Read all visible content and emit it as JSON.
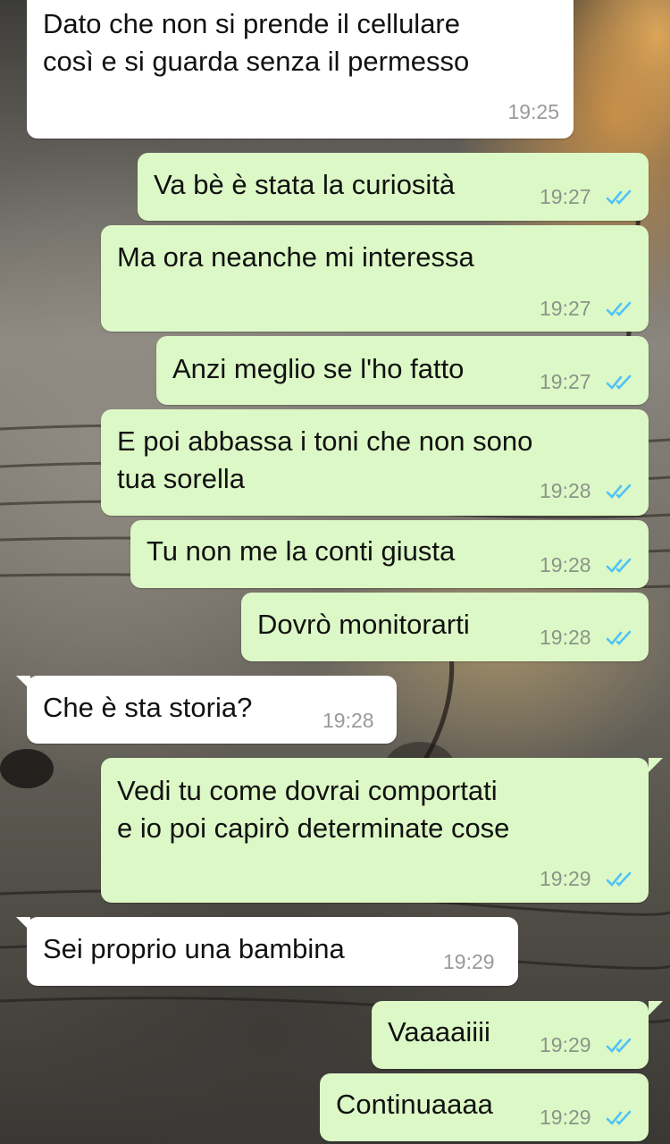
{
  "chat": {
    "messages": [
      {
        "direction": "in",
        "text": "Dato che non si prende il cellulare\ncosì e si guarda senza il permesso",
        "time": "19:25"
      },
      {
        "direction": "out",
        "text": "Va bè è stata la curiosità",
        "time": "19:27",
        "status": "read"
      },
      {
        "direction": "out",
        "text": "Ma ora neanche mi interessa",
        "time": "19:27",
        "status": "read"
      },
      {
        "direction": "out",
        "text": "Anzi meglio se l'ho fatto",
        "time": "19:27",
        "status": "read"
      },
      {
        "direction": "out",
        "text": "E poi abbassa i toni che non sono\ntua sorella",
        "time": "19:28",
        "status": "read"
      },
      {
        "direction": "out",
        "text": "Tu non me la conti giusta",
        "time": "19:28",
        "status": "read"
      },
      {
        "direction": "out",
        "text": "Dovrò monitorarti",
        "time": "19:28",
        "status": "read"
      },
      {
        "direction": "in",
        "text": "Che è sta storia?",
        "time": "19:28"
      },
      {
        "direction": "out",
        "text": "Vedi tu come dovrai comportati\ne io poi capirò determinate cose",
        "time": "19:29",
        "status": "read"
      },
      {
        "direction": "in",
        "text": "Sei proprio una bambina",
        "time": "19:29"
      },
      {
        "direction": "out",
        "text": "Vaaaaiiii",
        "time": "19:29",
        "status": "read"
      },
      {
        "direction": "out",
        "text": "Continuaaaa",
        "time": "19:29",
        "status": "read"
      }
    ]
  },
  "colors": {
    "outgoing_bubble": "#dcf8c6",
    "incoming_bubble": "#ffffff",
    "read_ticks": "#4fc3f7"
  },
  "icons": {
    "read_receipt": "double-check-icon"
  }
}
